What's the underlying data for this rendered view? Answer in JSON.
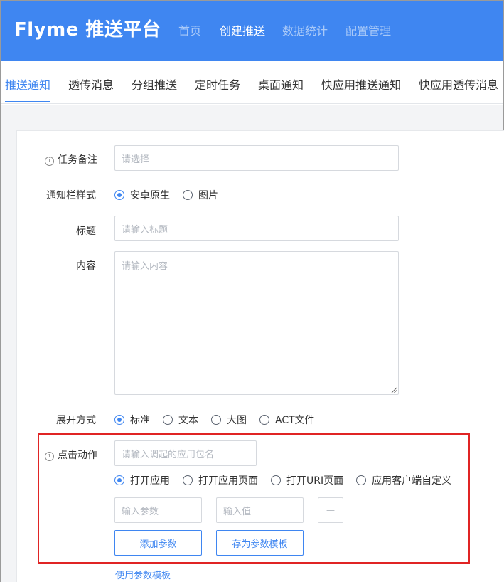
{
  "brand": {
    "name": "Flyme 推送平台"
  },
  "top_nav": [
    "首页",
    "创建推送",
    "数据统计",
    "配置管理"
  ],
  "top_nav_active": "创建推送",
  "sub_nav": [
    "推送通知",
    "透传消息",
    "分组推送",
    "定时任务",
    "桌面通知",
    "快应用推送通知",
    "快应用透传消息"
  ],
  "sub_nav_active": "推送通知",
  "form": {
    "task_note": {
      "label": "任务备注",
      "placeholder": "请选择",
      "icon": "info-icon"
    },
    "notify_style": {
      "label": "通知栏样式",
      "options": [
        "安卓原生",
        "图片"
      ],
      "selected": "安卓原生"
    },
    "title": {
      "label": "标题",
      "placeholder": "请输入标题"
    },
    "content": {
      "label": "内容",
      "placeholder": "请输入内容"
    },
    "expand_mode": {
      "label": "展开方式",
      "options": [
        "标准",
        "文本",
        "大图",
        "ACT文件"
      ],
      "selected": "标准"
    },
    "click_action": {
      "label": "点击动作",
      "icon": "info-icon",
      "package_placeholder": "请输入调起的应用包名",
      "options": [
        "打开应用",
        "打开应用页面",
        "打开URI页面",
        "应用客户端自定义"
      ],
      "selected": "打开应用",
      "param_key_placeholder": "输入参数",
      "param_value_placeholder": "输入值",
      "remove_label": "—",
      "add_param_label": "添加参数",
      "save_template_label": "存为参数模板",
      "use_template_label": "使用参数模板"
    }
  },
  "colors": {
    "primary": "#3f86f1",
    "highlight": "#e02424"
  }
}
